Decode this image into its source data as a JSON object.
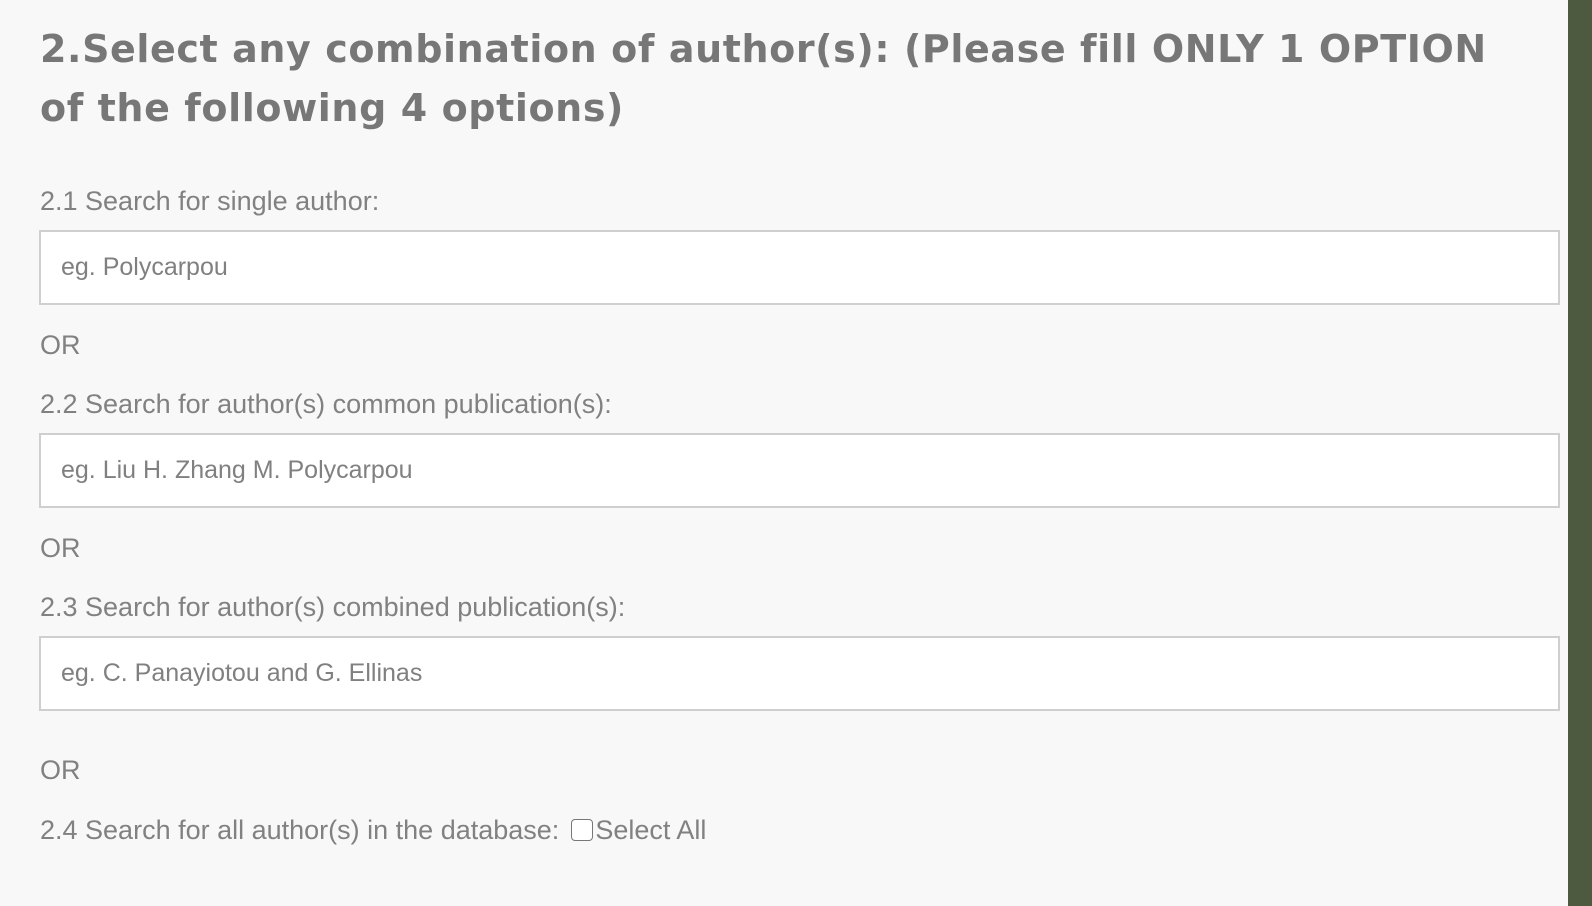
{
  "section": {
    "heading": "2.Select any combination of author(s): (Please fill ONLY 1 OPTION of the following 4 options)"
  },
  "options": {
    "single_author": {
      "label": "2.1 Search for single author:",
      "placeholder": "eg. Polycarpou",
      "value": ""
    },
    "or_1": "OR",
    "common_publications": {
      "label": "2.2 Search for author(s) common publication(s):",
      "placeholder": "eg. Liu H. Zhang M. Polycarpou",
      "value": ""
    },
    "or_2": "OR",
    "combined_publications": {
      "label": "2.3 Search for author(s) combined publication(s):",
      "placeholder": "eg. C. Panayiotou and G. Ellinas",
      "value": ""
    },
    "or_3": "OR",
    "all_authors": {
      "label": "2.4 Search for all author(s) in the database:",
      "checkbox_label": "Select All",
      "checked": false
    }
  }
}
